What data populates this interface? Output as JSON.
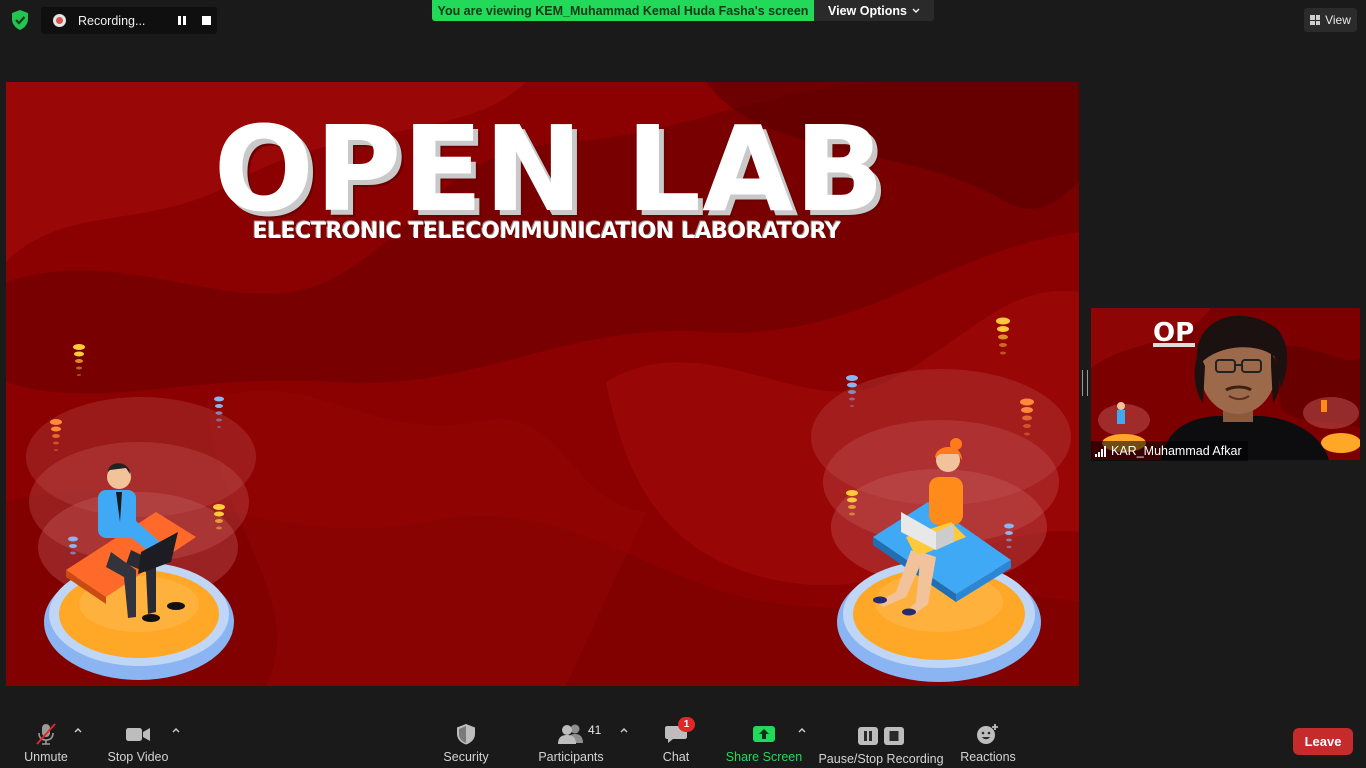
{
  "top_bar": {
    "recording_label": "Recording...",
    "viewing_banner": "You are viewing KEM_Muhammad Kemal Huda Fasha's screen",
    "view_options_label": "View Options",
    "view_label": "View"
  },
  "shared_screen": {
    "title": "OPEN LAB",
    "subtitle": "ELECTRONIC TELECOMMUNICATION LABORATORY"
  },
  "video_tile": {
    "participant_name": "KAR_Muhammad Afkar"
  },
  "toolbar": {
    "unmute_label": "Unmute",
    "stop_video_label": "Stop Video",
    "security_label": "Security",
    "participants_label": "Participants",
    "participants_count": "41",
    "chat_label": "Chat",
    "chat_badge": "1",
    "share_screen_label": "Share Screen",
    "pause_stop_recording_label": "Pause/Stop Recording",
    "reactions_label": "Reactions",
    "leave_label": "Leave"
  },
  "colors": {
    "banner_green": "#23d959",
    "share_green": "#23d959",
    "leave_red": "#c52b2b",
    "slide_red": "#8a0000"
  }
}
